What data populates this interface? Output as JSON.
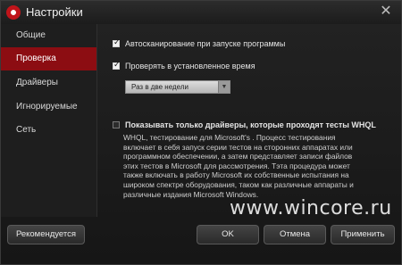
{
  "window": {
    "title": "Настройки"
  },
  "sidebar": {
    "items": [
      {
        "label": "Общие",
        "active": false
      },
      {
        "label": "Проверка",
        "active": true
      },
      {
        "label": "Драйверы",
        "active": false
      },
      {
        "label": "Игнорируемые",
        "active": false
      },
      {
        "label": "Сеть",
        "active": false
      }
    ]
  },
  "settings": {
    "autoscan": {
      "label": "Автосканирование при запуске программы",
      "checked": true
    },
    "scheduled": {
      "label": "Проверять в установленное время",
      "checked": true
    },
    "schedule_select": {
      "value": "Раз в две недели"
    },
    "whql": {
      "label": "Показывать только драйверы, которые проходят тесты WHQL",
      "checked": false,
      "description": "WHQL, тестирование для Microsoft's . Процесс тестирования включает в себя запуск серии тестов на сторонних аппаратах или программном обеспечении, а затем представляет  записи файлов этих тестов в Microsoft для рассмотрения. Тэта процедура может также включать в работу Microsoft их собственные испытания на широком спектре оборудования, таком как различные аппараты и различные издания Microsoft Windows."
    }
  },
  "footer": {
    "recommended_label": "Рекомендуется",
    "ok_label": "OK",
    "cancel_label": "Отмена",
    "apply_label": "Применить"
  },
  "watermark": "www.wincore.ru",
  "colors": {
    "accent": "#8c0d12",
    "background": "#1b1b1b"
  }
}
